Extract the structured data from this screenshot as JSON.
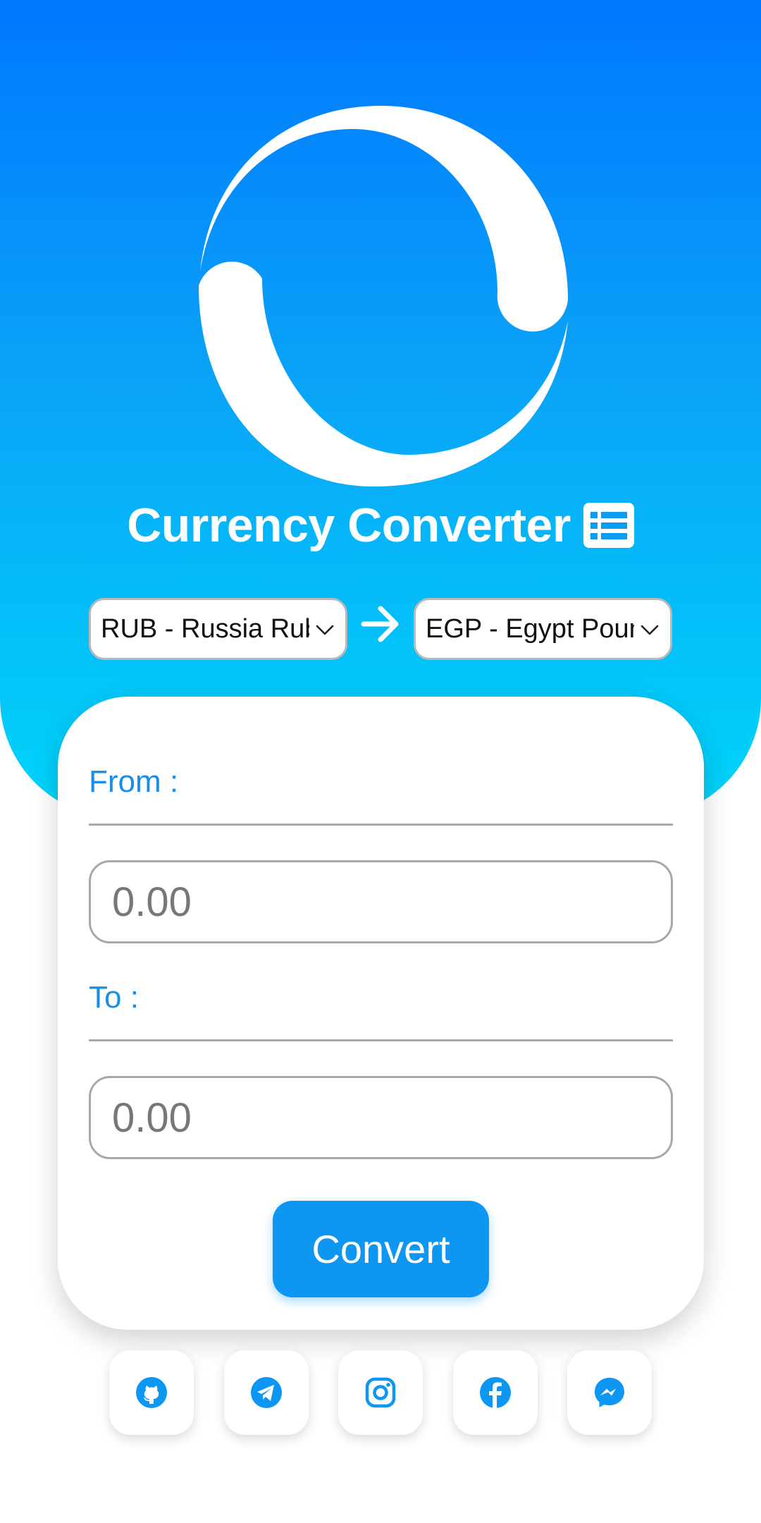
{
  "app": {
    "title": "Currency Converter"
  },
  "selectors": {
    "from_currency": "RUB - Russia Ruble",
    "to_currency": "EGP - Egypt Pound"
  },
  "form": {
    "from_label": "From :",
    "to_label": "To :",
    "from_placeholder": "0.00",
    "to_placeholder": "0.00",
    "convert_label": "Convert"
  },
  "socials": [
    {
      "icon": "github-icon"
    },
    {
      "icon": "telegram-icon"
    },
    {
      "icon": "instagram-icon"
    },
    {
      "icon": "facebook-icon"
    },
    {
      "icon": "messenger-icon"
    }
  ],
  "colors": {
    "gradient_top": "#0078ff",
    "gradient_bottom": "#00d5fb",
    "accent": "#0d96f2",
    "label": "#1a8de4"
  }
}
